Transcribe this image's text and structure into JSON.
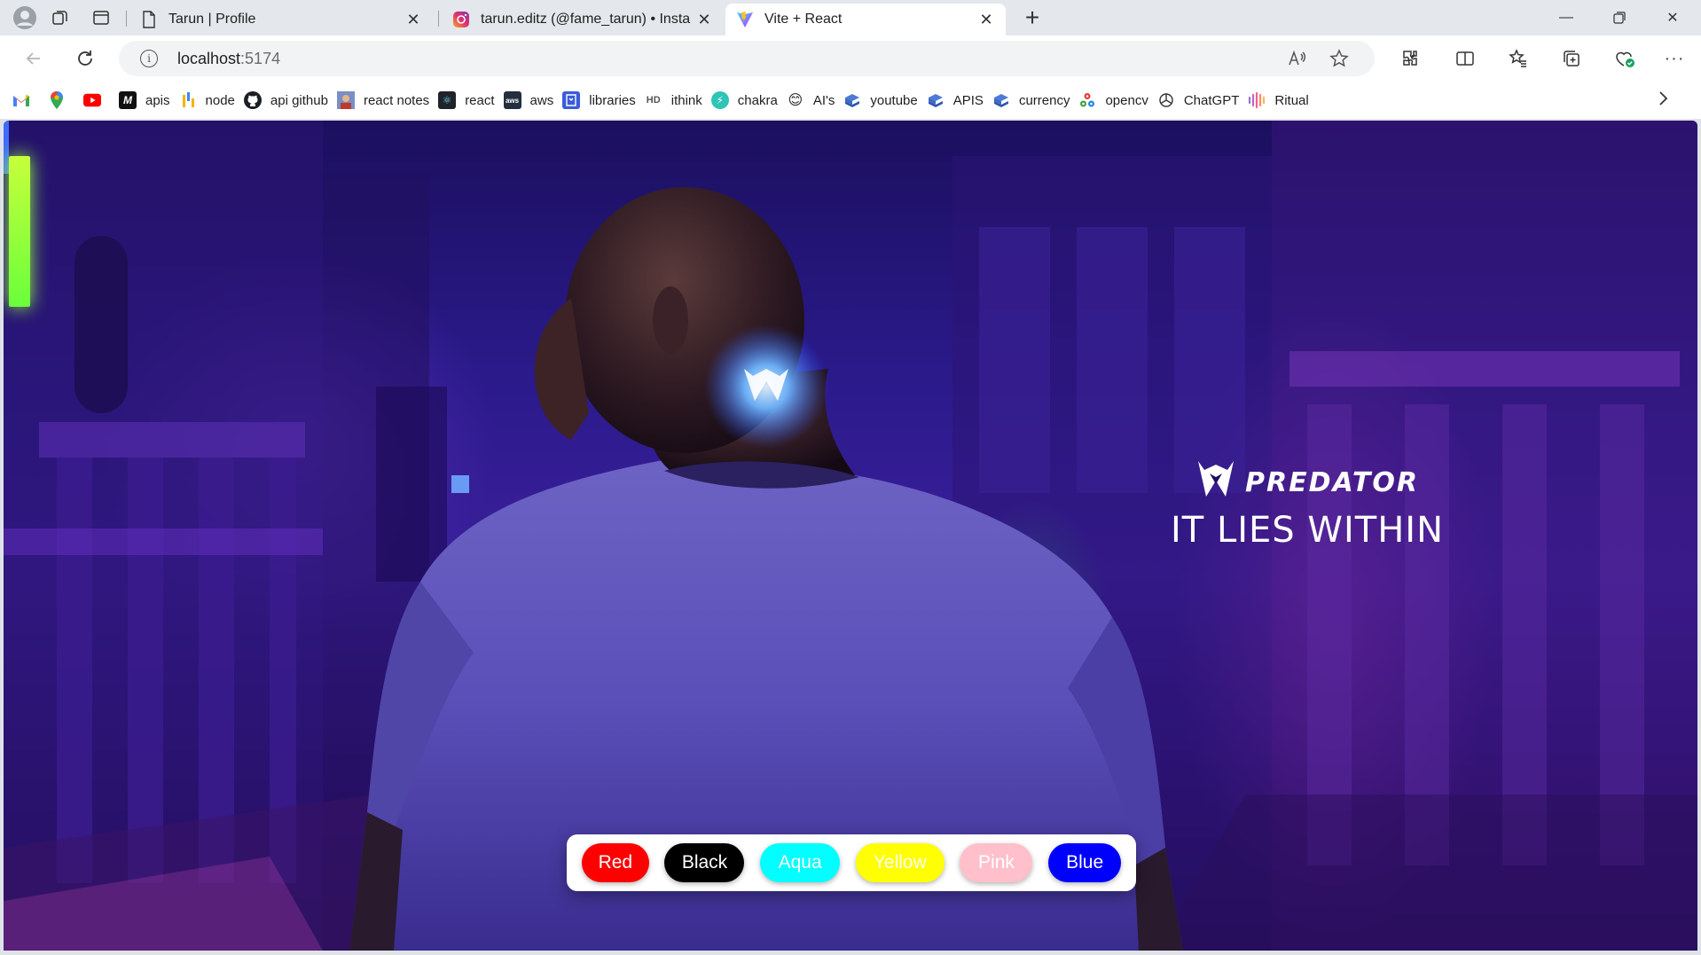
{
  "browser": {
    "tabs": [
      {
        "title": "Tarun | Profile",
        "icon": "page-icon",
        "active": false
      },
      {
        "title": "tarun.editz (@fame_tarun) • Insta",
        "icon": "instagram-icon",
        "active": false
      },
      {
        "title": "Vite + React",
        "icon": "vite-icon",
        "active": true
      }
    ],
    "new_tab_glyph": "+",
    "address": {
      "host": "localhost",
      "port": ":5174"
    },
    "bookmarks": [
      {
        "label": "",
        "icon": "gmail-icon"
      },
      {
        "label": "",
        "icon": "maps-icon"
      },
      {
        "label": "",
        "icon": "youtube-icon"
      },
      {
        "label": "apis",
        "icon": "m-icon"
      },
      {
        "label": "node",
        "icon": "bar-icon"
      },
      {
        "label": "api github",
        "icon": "github-icon"
      },
      {
        "label": "react notes",
        "icon": "avatar-icon"
      },
      {
        "label": "react",
        "icon": "react-icon"
      },
      {
        "label": "aws",
        "icon": "aws-icon"
      },
      {
        "label": "libraries",
        "icon": "book-icon"
      },
      {
        "label": "ithink",
        "icon": "ithink-icon"
      },
      {
        "label": "chakra",
        "icon": "chakra-icon"
      },
      {
        "label": "AI's",
        "icon": "emoji-icon"
      },
      {
        "label": "youtube",
        "icon": "folder-icon"
      },
      {
        "label": "APIS",
        "icon": "folder-icon"
      },
      {
        "label": "currency",
        "icon": "folder-icon"
      },
      {
        "label": "opencv",
        "icon": "opencv-icon"
      },
      {
        "label": "ChatGPT",
        "icon": "chatgpt-icon"
      },
      {
        "label": "Ritual",
        "icon": "ritual-icon"
      }
    ]
  },
  "page": {
    "brand_name": "PREDATOR",
    "tagline": "IT LIES WITHIN",
    "color_buttons": [
      {
        "label": "Red",
        "bg": "#ff0000",
        "fg": "#ffffff"
      },
      {
        "label": "Black",
        "bg": "#000000",
        "fg": "#ffffff"
      },
      {
        "label": "Aqua",
        "bg": "#00ffff",
        "fg": "#ffffff"
      },
      {
        "label": "Yellow",
        "bg": "#ffff00",
        "fg": "#ffffff"
      },
      {
        "label": "Pink",
        "bg": "#ffc0cb",
        "fg": "#ffffff"
      },
      {
        "label": "Blue",
        "bg": "#0000ff",
        "fg": "#ffffff"
      }
    ]
  }
}
